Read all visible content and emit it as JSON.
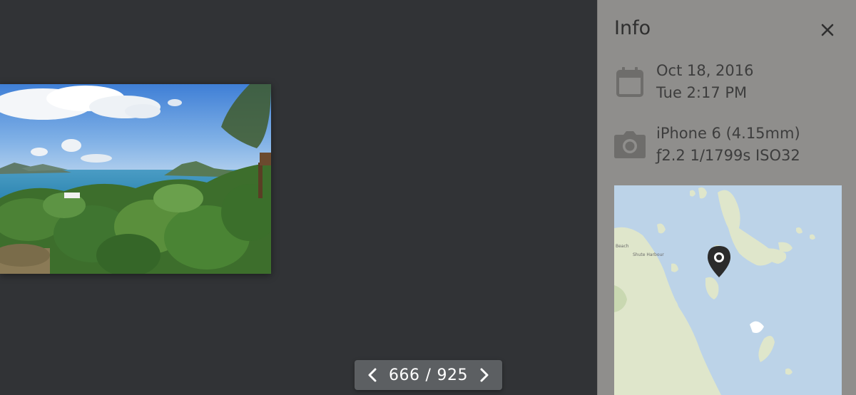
{
  "viewer": {
    "pager": {
      "current": "666",
      "separator": "/",
      "total": "925"
    }
  },
  "info_panel": {
    "title": "Info",
    "date": {
      "line1": "Oct 18, 2016",
      "line2": "Tue 2:17 PM"
    },
    "camera": {
      "line1": "iPhone 6 (4.15mm)",
      "line2": "ƒ2.2 1/1799s ISO32"
    },
    "map": {
      "labels": [
        "Beach",
        "Shute Harbour"
      ]
    }
  },
  "colors": {
    "viewer_background": "#313336",
    "panel_background": "#8f8e8c",
    "pager_background": "#5c5f62",
    "map_water": "#bcd3e8",
    "map_land": "#dfe6cb",
    "pin": "#2b2b2b"
  },
  "icons": {
    "prev": "chevron-left-icon",
    "next": "chevron-right-icon",
    "close": "close-icon",
    "date": "calendar-icon",
    "camera": "camera-icon",
    "pin": "map-pin-icon"
  }
}
